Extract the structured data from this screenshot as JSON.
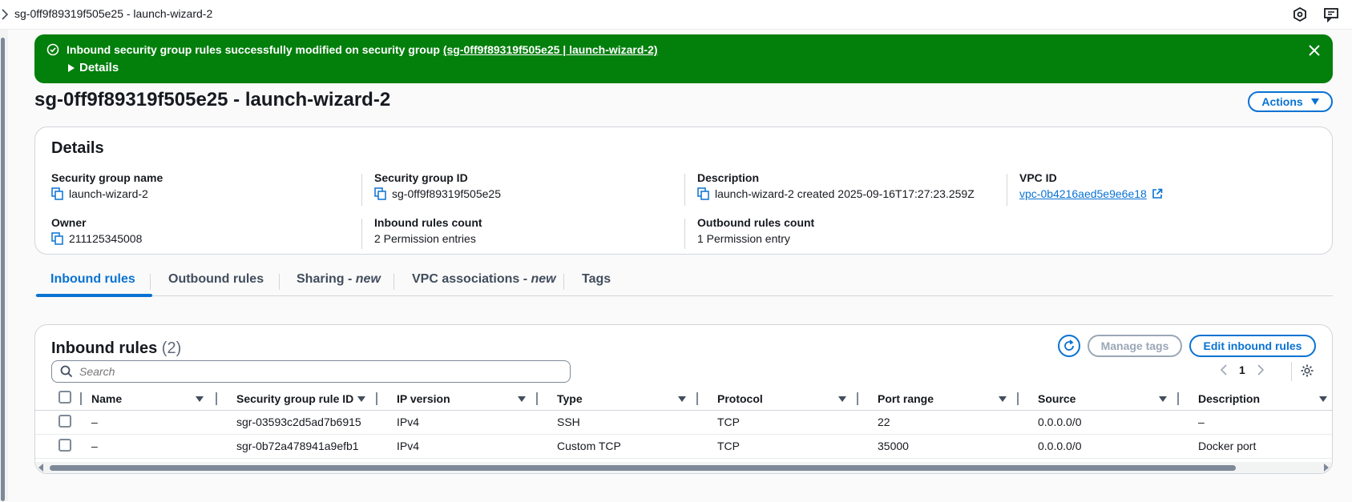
{
  "topbar": {
    "title": "sg-0ff9f89319f505e25 - launch-wizard-2",
    "icons": [
      "chevron-right-icon",
      "hexagon-settings-icon",
      "feedback-icon"
    ]
  },
  "flash": {
    "message": "Inbound security group rules successfully modified on security group",
    "link": "(sg-0ff9f89319f505e25 | launch-wizard-2)",
    "details_label": "Details",
    "color": "#037f0c"
  },
  "page": {
    "title": "sg-0ff9f89319f505e25 - launch-wizard-2",
    "actions_label": "Actions"
  },
  "details": {
    "heading": "Details",
    "sg_name_label": "Security group name",
    "sg_name": "launch-wizard-2",
    "sg_id_label": "Security group ID",
    "sg_id": "sg-0ff9f89319f505e25",
    "description_label": "Description",
    "description": "launch-wizard-2 created 2025-09-16T17:27:23.259Z",
    "vpc_label": "VPC ID",
    "vpc_id": "vpc-0b4216aed5e9e6e18",
    "owner_label": "Owner",
    "owner": "211125345008",
    "inbound_count_label": "Inbound rules count",
    "inbound_count": "2 Permission entries",
    "outbound_count_label": "Outbound rules count",
    "outbound_count": "1 Permission entry"
  },
  "tabs": {
    "inbound": "Inbound rules",
    "outbound": "Outbound rules",
    "sharing": "Sharing - ",
    "sharing_new": "new",
    "vpc_assoc": "VPC associations - ",
    "vpc_assoc_new": "new",
    "tags": "Tags"
  },
  "rules": {
    "heading": "Inbound rules",
    "count": "(2)",
    "manage_tags_label": "Manage tags",
    "edit_label": "Edit inbound rules",
    "search_placeholder": "Search",
    "page_number": "1",
    "columns": [
      "Name",
      "Security group rule ID",
      "IP version",
      "Type",
      "Protocol",
      "Port range",
      "Source",
      "Description"
    ],
    "rows": [
      [
        "–",
        "sgr-03593c2d5ad7b6915",
        "IPv4",
        "SSH",
        "TCP",
        "22",
        "0.0.0.0/0",
        "–"
      ],
      [
        "–",
        "sgr-0b72a478941a9efb1",
        "IPv4",
        "Custom TCP",
        "TCP",
        "35000",
        "0.0.0.0/0",
        "Docker port"
      ]
    ]
  },
  "colors": {
    "accent": "#0972d3",
    "success": "#037f0c"
  }
}
